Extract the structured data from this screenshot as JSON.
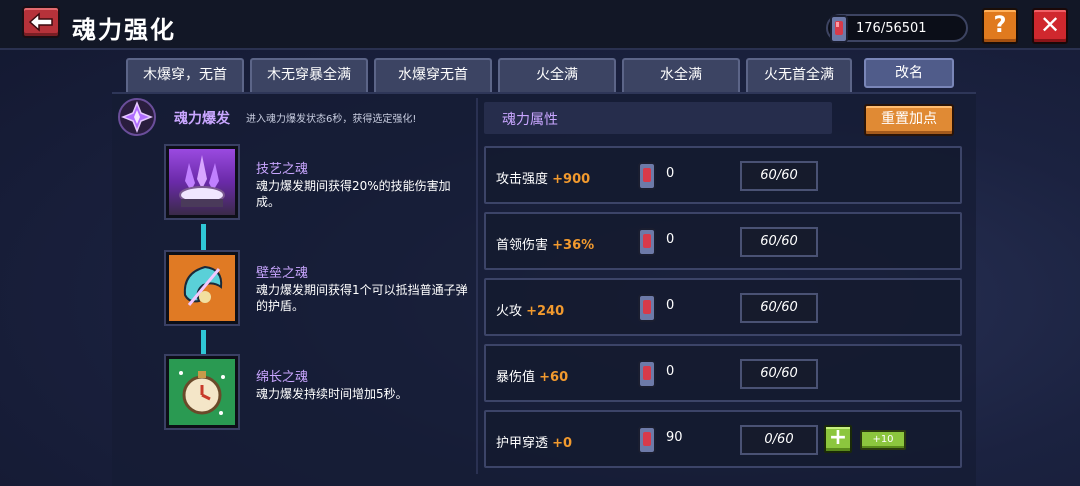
{
  "header": {
    "title": "魂力强化",
    "currency_text": "176/56501",
    "help_label": "?",
    "close_label": "✕"
  },
  "tabs": [
    {
      "label": "木爆穿，无首"
    },
    {
      "label": "木无穿暴全满"
    },
    {
      "label": "水爆穿无首"
    },
    {
      "label": "火全满"
    },
    {
      "label": "水全满"
    },
    {
      "label": "火无首全满"
    }
  ],
  "rename_label": "改名",
  "burst": {
    "title": "魂力爆发",
    "desc": "进入魂力爆发状态6秒，获得选定强化!"
  },
  "skills": [
    {
      "name": "技艺之魂",
      "desc": "魂力爆发期间获得20%的技能伤害加成。"
    },
    {
      "name": "壁垒之魂",
      "desc": "魂力爆发期间获得1个可以抵挡普通子弹的护盾。"
    },
    {
      "name": "绵长之魂",
      "desc": "魂力爆发持续时间增加5秒。"
    }
  ],
  "attr_header": "魂力属性",
  "reset_label": "重置加点",
  "attributes": [
    {
      "name": "攻击强度",
      "bonus": "+900",
      "count": "0",
      "level": "60/60"
    },
    {
      "name": "首领伤害",
      "bonus": "+36%",
      "count": "0",
      "level": "60/60"
    },
    {
      "name": "火攻",
      "bonus": "+240",
      "count": "0",
      "level": "60/60"
    },
    {
      "name": "暴伤值",
      "bonus": "+60",
      "count": "0",
      "level": "60/60"
    },
    {
      "name": "护甲穿透",
      "bonus": "+0",
      "count": "90",
      "level": "0/60"
    }
  ],
  "plus_label": "+",
  "plus10_label": "+10",
  "colors": {
    "accent_orange": "#f29a2e",
    "purple_text": "#c9a6ff",
    "green_button": "#8cc63e",
    "connector_cyan": "#2fc7d6"
  },
  "icons": [
    "back-arrow-icon",
    "soul-gem-icon",
    "burst-sigil-icon",
    "skill-crystal-icon",
    "shield-icon",
    "clock-icon"
  ]
}
